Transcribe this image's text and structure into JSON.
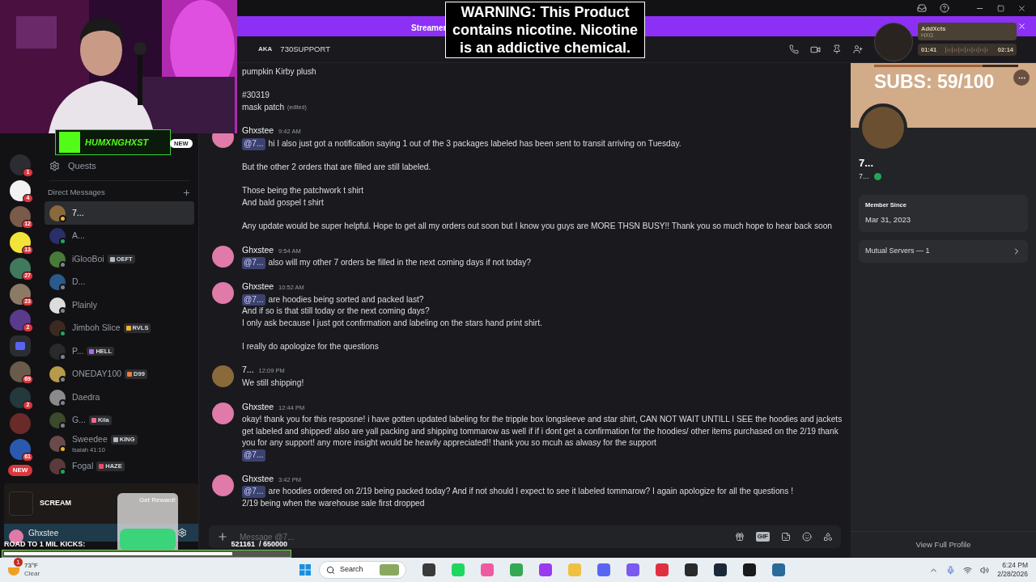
{
  "banner": {
    "text": "Streamer"
  },
  "warning": {
    "text": "WARNING: This Product contains nicotine. Nicotine is an addictive chemical."
  },
  "stream_overlay": {
    "channel": "HUMXNGHXST",
    "new_badge": "NEW",
    "subs": "SUBS: 59/100",
    "kicks_goal": {
      "label": "ROAD TO 1 MIL KICKS:",
      "count": "521161  / 650000",
      "level": 0.8
    },
    "reward": "Get Reward!",
    "ad_title": "SCREAM"
  },
  "player": {
    "title": "AddXcts",
    "artist": "HXG",
    "elapsed": "01:41",
    "total": "02:14",
    "level": 0.75
  },
  "servers": [
    {
      "kind": "server",
      "color": "#2c2c32",
      "badge": "1"
    },
    {
      "kind": "server",
      "color": "#f2f2f2",
      "badge": "4"
    },
    {
      "kind": "server",
      "color": "#7a5a48",
      "badge": "12"
    },
    {
      "kind": "server",
      "color": "#f3e23a",
      "badge": "13"
    },
    {
      "kind": "server",
      "color": "#3f7a5c",
      "badge": "27"
    },
    {
      "kind": "server",
      "color": "#8c7a66",
      "badge": "23"
    },
    {
      "kind": "server",
      "color": "#5a3a8a",
      "badge": "2"
    },
    {
      "kind": "folder",
      "color": "#5865f2"
    },
    {
      "kind": "server",
      "color": "#6a5a4a",
      "badge": "69"
    },
    {
      "kind": "server",
      "color": "#23393c",
      "badge": "2"
    },
    {
      "kind": "server",
      "color": "#6a2a2a"
    },
    {
      "kind": "server",
      "color": "#2a5ab0",
      "badge": "61"
    },
    {
      "kind": "new",
      "label": "NEW"
    }
  ],
  "sidebar": {
    "quests": "Quests",
    "dm_heading": "Direct Messages",
    "dms": [
      {
        "name": "7...",
        "online": false,
        "idle": true,
        "selected": true,
        "color": "#8a6a3a"
      },
      {
        "name": "A...",
        "online": true,
        "idle": false,
        "selected": false,
        "color": "#2a2f6a"
      },
      {
        "name": "iGlooBoi",
        "online": false,
        "idle": false,
        "selected": false,
        "color": "#4a7a3a",
        "tag": {
          "text": "OEFT",
          "color": "#b5bac1"
        }
      },
      {
        "name": "D...",
        "online": false,
        "idle": false,
        "selected": false,
        "color": "#2a5a8a"
      },
      {
        "name": "Plainly",
        "online": false,
        "idle": false,
        "selected": false,
        "color": "#dcdcdc"
      },
      {
        "name": "Jimboh Slice",
        "online": true,
        "idle": false,
        "selected": false,
        "color": "#3a2a20",
        "tag": {
          "text": "RVLS",
          "color": "#f0b232"
        }
      },
      {
        "name": "P...",
        "online": false,
        "idle": false,
        "selected": false,
        "color": "#2a2a2a",
        "tag": {
          "text": "HELL",
          "color": "#a86af0"
        }
      },
      {
        "name": "ONEDAY100",
        "online": false,
        "idle": false,
        "selected": false,
        "color": "#b89a4a",
        "tag": {
          "text": "D99",
          "color": "#f07a3a"
        }
      },
      {
        "name": "Daedra",
        "online": false,
        "idle": false,
        "selected": false,
        "color": "#8a8a8a"
      },
      {
        "name": "G...",
        "online": false,
        "idle": false,
        "selected": false,
        "color": "#3a4a2a",
        "tag": {
          "text": "Kila",
          "color": "#f06a8a"
        }
      },
      {
        "name": "Sweedee",
        "online": false,
        "idle": true,
        "selected": false,
        "color": "#6a4a4a",
        "tag": {
          "text": "KING",
          "color": "#b5bac1"
        },
        "subtitle": "Isaiah 41:10"
      },
      {
        "name": "Fogal",
        "online": true,
        "idle": false,
        "selected": false,
        "color": "#5a3a3a",
        "tag": {
          "text": "HAZE",
          "color": "#f04a6a"
        }
      }
    ]
  },
  "user_panel": {
    "name": "Ghxstee"
  },
  "header": {
    "aka_label": "AKA",
    "aka": "730SUPPORT"
  },
  "messages": [
    {
      "paragraphs": [
        [
          {
            "text": "pumpkin Kirby plush"
          }
        ],
        [
          {
            "text": "#30319"
          },
          {
            "text": "mask patch",
            "edited": "(edited)"
          }
        ]
      ]
    },
    {
      "author": "Ghxstee",
      "time": "9:42 AM",
      "color": "#e07aa8",
      "paragraphs": [
        [
          {
            "mention": "@7...",
            "text": "hi I also just got a notification saying 1 out of the 3 packages labeled has been sent to transit arriving on Tuesday."
          }
        ],
        [
          {
            "text": "But the other 2 orders that are filled are still labeled."
          }
        ],
        [
          {
            "text": "Those being the patchwork t shirt"
          },
          {
            "text": "And bald gospel t shirt"
          }
        ],
        [
          {
            "text": "Any update would be super helpful. Hope to get all my orders out soon but I know you guys are MORE THSN BUSY!! Thank you so much hope to hear back soon"
          }
        ]
      ]
    },
    {
      "author": "Ghxstee",
      "time": "9:54 AM",
      "color": "#e07aa8",
      "paragraphs": [
        [
          {
            "mention": "@7...",
            "text": "also will my other 7 orders be filled in the next coming days if not today?"
          }
        ]
      ]
    },
    {
      "author": "Ghxstee",
      "time": "10:52 AM",
      "color": "#e07aa8",
      "paragraphs": [
        [
          {
            "mention": "@7...",
            "text": "are hoodies being sorted and packed last?"
          },
          {
            "text": "And if so is that still today or the next coming days?"
          },
          {
            "text": "I only ask because I just got confirmation and labeling  on the stars hand print shirt."
          }
        ],
        [
          {
            "text": "I really do apologize for the questions"
          }
        ]
      ]
    },
    {
      "author": "7...",
      "time": "12:09 PM",
      "color": "#8a6a3a",
      "paragraphs": [
        [
          {
            "text": "We still shipping!"
          }
        ]
      ]
    },
    {
      "author": "Ghxstee",
      "time": "12:44 PM",
      "color": "#e07aa8",
      "paragraphs": [
        [
          {
            "text": "okay! thank you for this resposne! i have gotten updated labeling for the tripple box longsleeve and star shirt, CAN NOT WAIT UNTILL I SEE the hoodies and jackets get labeled and shipped! also are yall packing and shipping tommarow as well if if i dont get a confirmation for the hoodies/ other items purchased on the 2/19 thank you for any support! any more insight would be heavily appreciated!! thank you so mcuh as alwasy for the support"
          },
          {
            "mention": "@7..."
          }
        ]
      ]
    },
    {
      "author": "Ghxstee",
      "time": "3:42 PM",
      "color": "#e07aa8",
      "paragraphs": [
        [
          {
            "mention": "@7...",
            "text": "are hoodies ordered on 2/19 being packed today? And if not should I expect to see it labeled tommarow? I again apologize for all the questions !"
          },
          {
            "text": "2/19 being when the warehouse sale first dropped"
          }
        ]
      ]
    }
  ],
  "composer": {
    "placeholder": "Message @7...",
    "gif": "GIF"
  },
  "profile": {
    "name": "7...",
    "username": "7...",
    "member_since_label": "Member Since",
    "member_since": "Mar 31, 2023",
    "mutual": "Mutual Servers — 1",
    "view_full": "View Full Profile"
  },
  "taskbar": {
    "weather_alert": "1",
    "temperature": "73°F",
    "condition": "Clear",
    "search": "Search",
    "time": "6:24 PM",
    "date": "2/28/2026"
  }
}
